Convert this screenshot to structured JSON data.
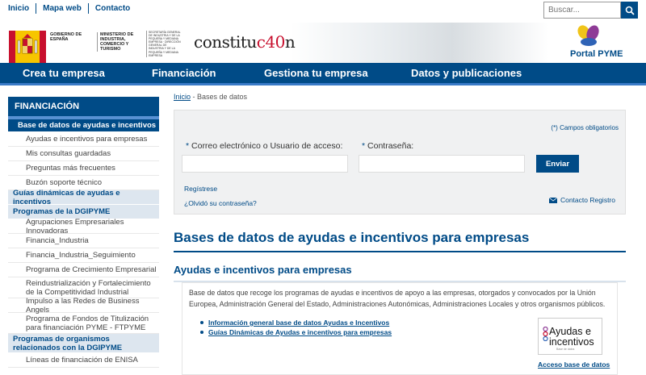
{
  "top_links": [
    "Inicio",
    "Mapa web",
    "Contacto"
  ],
  "search": {
    "placeholder": "Buscar..."
  },
  "header": {
    "gobierno": "GOBIERNO DE ESPAÑA",
    "ministerio": "MINISTERIO DE INDUSTRIA, COMERCIO Y TURISMO",
    "secretaria": "SECRETARÍA GENERAL DE INDUSTRIA Y DE LA PEQUEÑA Y MEDIANA EMPRESA · DIRECCIÓN GENERAL DE INDUSTRIA Y DE LA PEQUEÑA Y MEDIANA EMPRESA",
    "constitucion_a": "constitu",
    "constitucion_b": "c40",
    "constitucion_c": "n",
    "portal": "Portal PYME"
  },
  "nav": [
    "Crea tu empresa",
    "Financiación",
    "Gestiona tu empresa",
    "Datos y publicaciones"
  ],
  "sidebar": {
    "title": "FINANCIACIÓN",
    "items": [
      {
        "label": "Base de datos de ayudas e incentivos",
        "kind": "active"
      },
      {
        "label": "Ayudas e incentivos para empresas",
        "kind": "sub"
      },
      {
        "label": "Mis consultas guardadas",
        "kind": "sub"
      },
      {
        "label": "Preguntas más frecuentes",
        "kind": "sub"
      },
      {
        "label": "Buzón soporte técnico",
        "kind": "sub"
      },
      {
        "label": "Guías dinámicas de ayudas e incentivos",
        "kind": "group"
      },
      {
        "label": "Programas de la DGIPYME",
        "kind": "group"
      },
      {
        "label": "Agrupaciones Empresariales Innovadoras",
        "kind": "sub"
      },
      {
        "label": "Financia_Industria",
        "kind": "sub"
      },
      {
        "label": "Financia_Industria_Seguimiento",
        "kind": "sub"
      },
      {
        "label": "Programa de Crecimiento Empresarial",
        "kind": "sub"
      },
      {
        "label": "Reindustrialización y Fortalecimiento de la Competitividad Industrial",
        "kind": "sub"
      },
      {
        "label": "Impulso a las Redes de Business Angels",
        "kind": "sub"
      },
      {
        "label": "Programa de Fondos de Titulización para financiación PYME - FTPYME",
        "kind": "sub"
      },
      {
        "label": "Programas de organismos relacionados con la DGIPYME",
        "kind": "group"
      },
      {
        "label": "Líneas de financiación de ENISA",
        "kind": "sub"
      }
    ]
  },
  "breadcrumb": {
    "home": "Inicio",
    "sep": " - ",
    "current": "Bases de datos"
  },
  "login": {
    "required_note": "(*) Campos obligatorios",
    "user_label": "Correo electrónico o Usuario de acceso:",
    "password_label": "Contraseña:",
    "asterisk": "*",
    "submit": "Enviar",
    "register": "Regístrese",
    "forgot": "¿Olvidó su contraseña?",
    "contact": "Contacto Registro"
  },
  "main": {
    "title": "Bases de datos de ayudas e incentivos para empresas",
    "subtitle": "Ayudas e incentivos para empresas",
    "description": "Base de datos que recoge los programas de ayudas e incentivos de apoyo a las empresas, otorgados y convocados por la Unión Europea, Administración General del Estado, Administraciones Autonómicas, Administraciones Locales y otros organismos públicos.",
    "links": [
      "Información general base de datos Ayudas e Incentivos",
      "Guías Dinámicas de Ayudas e incentivos para empresas"
    ],
    "logo_text": "Ayudas e incentivos",
    "logo_small": "Base de datos",
    "access_link": "Acceso base de datos"
  },
  "colors": {
    "brand": "#004b87",
    "nav_underline": "#3a7bc8",
    "accent_red": "#c8102e"
  }
}
